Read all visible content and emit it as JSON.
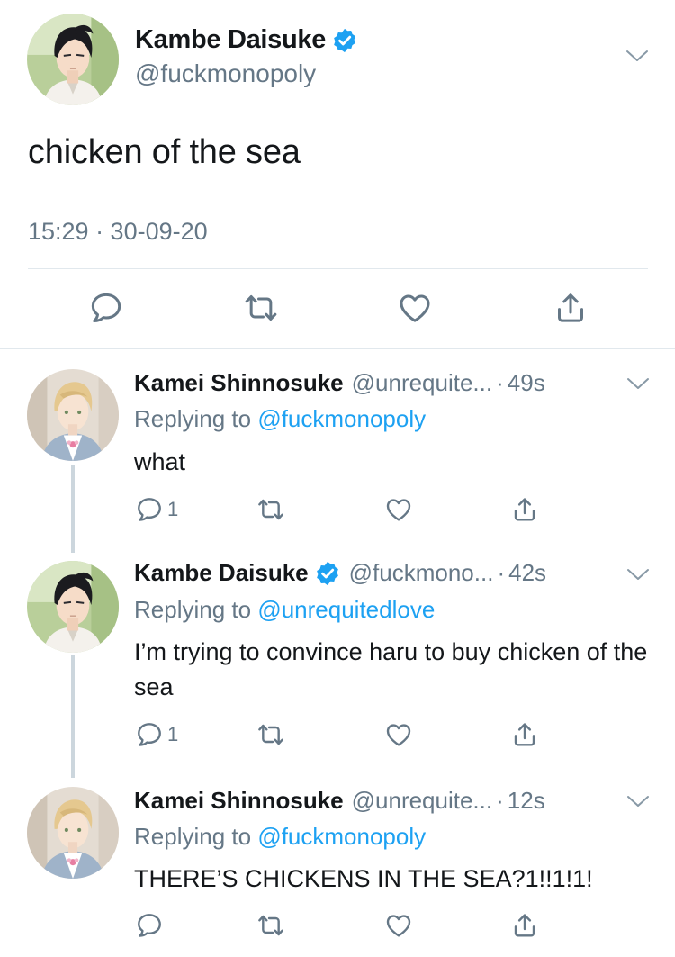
{
  "main_tweet": {
    "name": "Kambe Daisuke",
    "handle": "@fuckmonopoly",
    "text": "chicken of the sea",
    "timestamp": "15:29 · 30-09-20",
    "verified": true
  },
  "replies": [
    {
      "name": "Kamei Shinnosuke",
      "handle": "@unrequite...",
      "dot": "·",
      "time": "49s",
      "replying_prefix": "Replying to",
      "replying_to": "@fuckmonopoly",
      "text": "what",
      "reply_count": "1",
      "verified": false
    },
    {
      "name": "Kambe Daisuke",
      "handle": "@fuckmono...",
      "dot": "·",
      "time": "42s",
      "replying_prefix": "Replying to",
      "replying_to": "@unrequitedlove",
      "text": "I’m trying to convince haru to buy chicken of the sea",
      "reply_count": "1",
      "verified": true
    },
    {
      "name": "Kamei Shinnosuke",
      "handle": "@unrequite...",
      "dot": "·",
      "time": "12s",
      "replying_prefix": "Replying to",
      "replying_to": "@fuckmonopoly",
      "text": "THERE’S CHICKENS IN THE SEA?1!!1!1!",
      "reply_count": "",
      "verified": false
    }
  ],
  "icons": {
    "reply": "speech-bubble-icon",
    "retweet": "retweet-arrows-icon",
    "like": "heart-icon",
    "share": "share-upload-icon",
    "verified": "verified-badge-icon",
    "more": "chevron-down-icon"
  },
  "colors": {
    "accent": "#1da1f2",
    "text": "#14171a",
    "secondary": "#657786",
    "divider": "#e1e8ed",
    "thread_line": "#ccd6dd"
  }
}
